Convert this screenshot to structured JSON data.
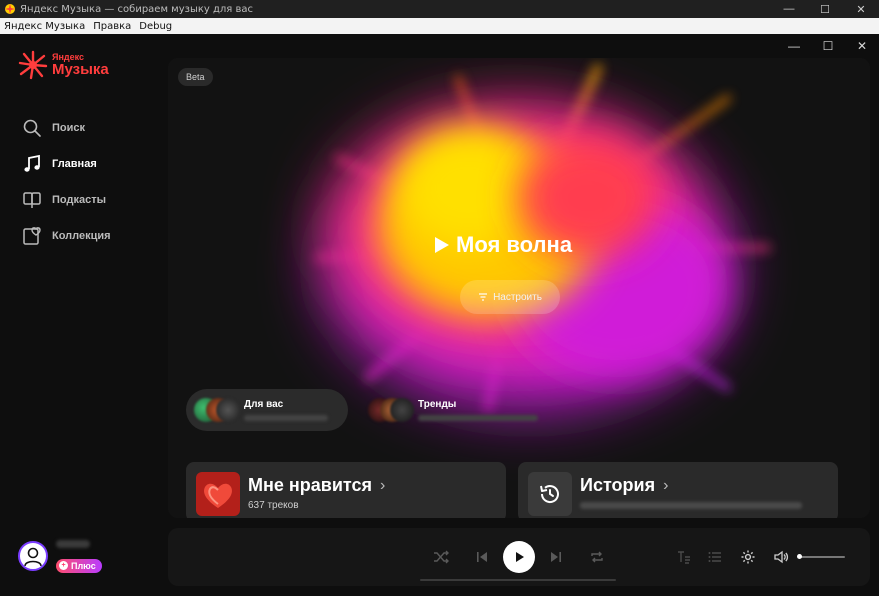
{
  "os_window": {
    "title": "Яндекс Музыка — собираем музыку для вас",
    "controls": {
      "minimize": "—",
      "maximize": "☐",
      "close": "✕"
    }
  },
  "menubar": {
    "items": [
      "Яндекс Музыка",
      "Правка",
      "Debug"
    ]
  },
  "app_controls": {
    "minimize": "—",
    "maximize": "☐",
    "close": "✕"
  },
  "logo": {
    "line1": "Яндекс",
    "line2": "Музыка",
    "color": "#ff3d3d"
  },
  "sidebar": {
    "items": [
      {
        "label": "Поиск",
        "icon": "search-icon",
        "active": false
      },
      {
        "label": "Главная",
        "icon": "music-note-icon",
        "active": true
      },
      {
        "label": "Подкасты",
        "icon": "podcast-icon",
        "active": false
      },
      {
        "label": "Коллекция",
        "icon": "collection-heart-icon",
        "active": false
      }
    ]
  },
  "user": {
    "plus_label": "Плюс"
  },
  "wave": {
    "beta_label": "Beta",
    "title": "Моя волна",
    "tune_label": "Настроить"
  },
  "chips": [
    {
      "label": "Для вас"
    },
    {
      "label": "Тренды"
    }
  ],
  "cards": {
    "liked": {
      "title": "Мне нравится",
      "subtitle": "637 треков"
    },
    "history": {
      "title": "История"
    }
  },
  "player": {
    "icons": [
      "shuffle-icon",
      "previous-icon",
      "play-icon",
      "next-icon",
      "repeat-icon",
      "lyrics-icon",
      "queue-icon",
      "settings-icon",
      "volume-icon"
    ],
    "volume_level": 0.05
  },
  "colors": {
    "accent": "#ff3d3d",
    "plus_gradient_start": "#ff4d6d",
    "plus_gradient_end": "#b93cff"
  }
}
